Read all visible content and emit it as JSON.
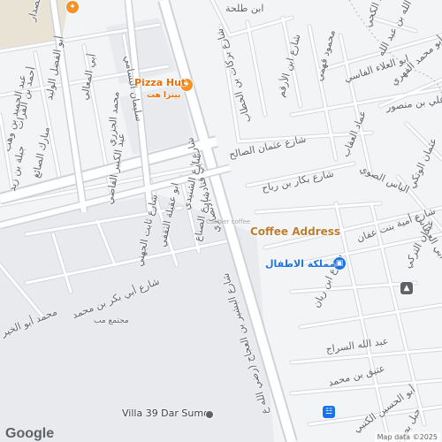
{
  "colors": {
    "background": "#f3f4f6",
    "road": "#ffffff",
    "road_edge": "#d3d7dc",
    "block": "#e8eaed",
    "sand": "#e9e3d6",
    "food_poi": "#f29227",
    "shop_poi": "#1a73e8",
    "park_poi": "#5f6368",
    "label": "#5f6368"
  },
  "streets": [
    {
      "name": "ابن طلحة",
      "font_size": 11
    },
    {
      "name": "أبو فراس الصدار",
      "font_size": 11
    },
    {
      "name": "سليمان البسامي",
      "font_size": 11
    },
    {
      "name": "أبو الفضل الوليد",
      "font_size": 11
    },
    {
      "name": "أبي المعالي",
      "font_size": 11
    },
    {
      "name": "أحمد بن الفرات",
      "font_size": 11
    },
    {
      "name": "عبد الحميد بن وهب",
      "font_size": 11
    },
    {
      "name": "مبارك الصائغ",
      "font_size": 11
    },
    {
      "name": "جبلة بن زيد",
      "font_size": 11
    },
    {
      "name": "محمد الجزري",
      "font_size": 11
    },
    {
      "name": "عبد الكبير الفاضي",
      "font_size": 11
    },
    {
      "name": "ابو عقيلة الثقفي",
      "font_size": 11
    },
    {
      "name": "شارع ثابت الجهني",
      "font_size": 11
    },
    {
      "name": "شارع أبي بكر بن محمد",
      "font_size": 11
    },
    {
      "name": "محمد أبو الخير",
      "font_size": 11
    },
    {
      "name": "شارع أبي قتادة الأنصاري",
      "font_size": 11
    },
    {
      "name": "شارع بركات بن الخطاب",
      "font_size": 11
    },
    {
      "name": "شارع ابن الأرقم",
      "font_size": 11
    },
    {
      "name": "شارع عثمان الصالح",
      "font_size": 11
    },
    {
      "name": "شارع بكار بن رباح",
      "font_size": 11
    },
    {
      "name": "شارع الشنيدي",
      "font_size": 11
    },
    {
      "name": "شارع الصناع",
      "font_size": 11
    },
    {
      "name": "محمود فهمي",
      "font_size": 11
    },
    {
      "name": "حمد الكحي",
      "font_size": 11
    },
    {
      "name": "عبد الله بن عبد الله",
      "font_size": 11
    },
    {
      "name": "أبو محمد الفهري",
      "font_size": 11
    },
    {
      "name": "ابو العلاء الفاسي",
      "font_size": 11
    },
    {
      "name": "علي بن منصور",
      "font_size": 11
    },
    {
      "name": "عماد العقاب",
      "font_size": 11
    },
    {
      "name": "الياس الصوي",
      "font_size": 11
    },
    {
      "name": "عثمان الوتكي",
      "font_size": 11
    },
    {
      "name": "أبي العطاس",
      "font_size": 11
    },
    {
      "name": "عبدان التركي",
      "font_size": 11
    },
    {
      "name": "شارع أمية بنت عفان",
      "font_size": 11
    },
    {
      "name": "شارع ابن ريان",
      "font_size": 11
    },
    {
      "name": "عبد الله السراج",
      "font_size": 11
    },
    {
      "name": "عتيق بن محمد",
      "font_size": 11
    },
    {
      "name": "أبو الحسين الكتبي",
      "font_size": 11
    },
    {
      "name": "حبل بصرة",
      "font_size": 11
    },
    {
      "name": "شارع البشير بن العجاج (رضي الله ع",
      "font_size": 11
    },
    {
      "name": "مجتمع مب",
      "font_size": 9
    },
    {
      "name": "Villa 39 Dar Sumo",
      "font_size": 11
    }
  ],
  "pois": [
    {
      "name": "Pizza Hut",
      "subname": "بيتزا هت",
      "icon": "restaurant-icon",
      "kind": "food"
    },
    {
      "name": "",
      "subname": "",
      "icon": "restaurant-icon",
      "kind": "food"
    },
    {
      "name": "مملكة الاطفال",
      "subname": "",
      "icon": "shopping-bag-icon",
      "kind": "shop"
    },
    {
      "name": "",
      "subname": "",
      "icon": "park-icon",
      "kind": "park"
    },
    {
      "name": "",
      "subname": "",
      "icon": "shopping-cart-icon",
      "kind": "shop"
    },
    {
      "name": "",
      "subname": "",
      "icon": "location-pin-icon",
      "kind": "park"
    }
  ],
  "overlay": {
    "coffee_label": "Coffee Address",
    "faded_label": "Cashier coffee"
  },
  "footer": {
    "google_logo": "Google",
    "attribution": "Map data ©2025"
  }
}
